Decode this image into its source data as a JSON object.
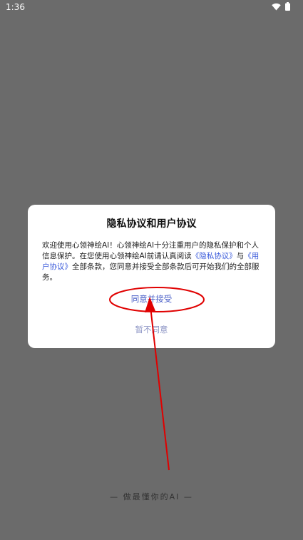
{
  "status_bar": {
    "time": "1:36",
    "icons": [
      "wifi-icon",
      "battery-icon"
    ]
  },
  "dialog": {
    "title": "隐私协议和用户协议",
    "body_intro": "欢迎使用心领神绘AI！心领神绘AI十分注重用户的隐私保护和个人信息保护。在您使用心领神绘AI前请认真阅读",
    "privacy_link": "《隐私协议》",
    "joiner": "与",
    "user_link": "《用户协议》",
    "body_outro": "全部条款，您同意并接受全部条款后可开始我们的全部服务。",
    "accept_label": "同意并接受",
    "decline_label": "暂不同意"
  },
  "slogan": "— 做最懂你的AI —",
  "colors": {
    "background": "#6b6b6b",
    "dialog_bg": "#ffffff",
    "link": "#3b5bdb",
    "accept": "#4c61c8",
    "decline": "#8f97c6",
    "annotation": "#e00000"
  }
}
